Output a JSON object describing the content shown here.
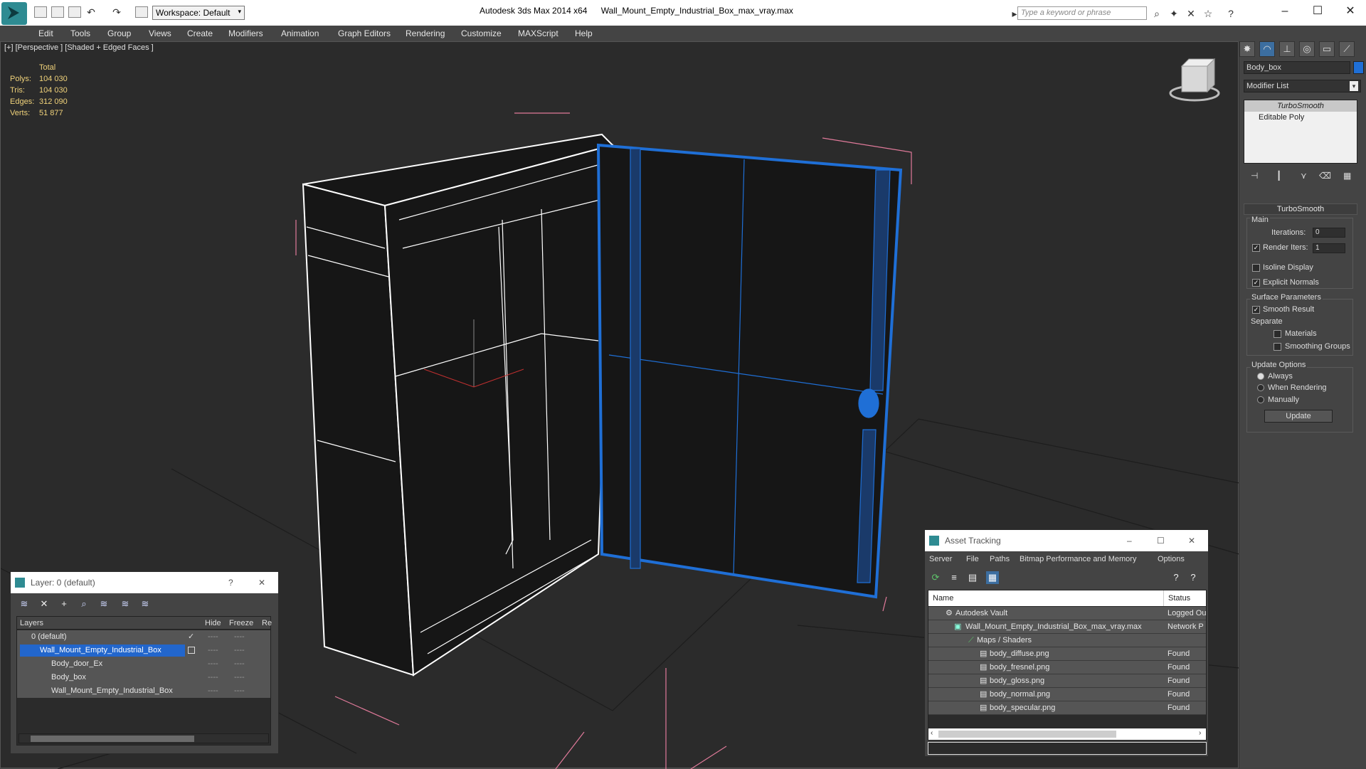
{
  "titlebar": {
    "workspace": "Workspace: Default",
    "app_title": "Autodesk 3ds Max  2014 x64",
    "file_name": "Wall_Mount_Empty_Industrial_Box_max_vray.max",
    "search_placeholder": "Type a keyword or phrase"
  },
  "menu": [
    "Edit",
    "Tools",
    "Group",
    "Views",
    "Create",
    "Modifiers",
    "Animation",
    "Graph Editors",
    "Rendering",
    "Customize",
    "MAXScript",
    "Help"
  ],
  "viewport": {
    "label": "[+] [Perspective ] [Shaded + Edged Faces ]",
    "stats": {
      "header": "Total",
      "rows": [
        {
          "label": "Polys:",
          "value": "104 030"
        },
        {
          "label": "Tris:",
          "value": "104 030"
        },
        {
          "label": "Edges:",
          "value": "312 090"
        },
        {
          "label": "Verts:",
          "value": "51 877"
        }
      ]
    }
  },
  "command_panel": {
    "object_name": "Body_box",
    "modifier_list": "Modifier List",
    "stack": [
      "TurboSmooth",
      "Editable Poly"
    ],
    "rollout_title": "TurboSmooth",
    "main_label": "Main",
    "iterations_label": "Iterations:",
    "iterations_value": "0",
    "render_iters_label": "Render Iters:",
    "render_iters_value": "1",
    "isoline_label": "Isoline Display",
    "explicit_normals_label": "Explicit Normals",
    "surface_params_label": "Surface Parameters",
    "smooth_result_label": "Smooth Result",
    "separate_label": "Separate",
    "materials_label": "Materials",
    "smoothing_groups_label": "Smoothing Groups",
    "update_options_label": "Update Options",
    "always_label": "Always",
    "when_rendering_label": "When Rendering",
    "manually_label": "Manually",
    "update_button": "Update"
  },
  "layer_window": {
    "title": "Layer: 0 (default)",
    "help": "?",
    "columns": [
      "Layers",
      "Hide",
      "Freeze",
      "Re"
    ],
    "rows": [
      {
        "name": "0 (default)",
        "hide": "----",
        "freeze": "----"
      },
      {
        "name": "Wall_Mount_Empty_Industrial_Box",
        "hide": "----",
        "freeze": "----"
      },
      {
        "name": "Body_door_Ex",
        "hide": "----",
        "freeze": "----"
      },
      {
        "name": "Body_box",
        "hide": "----",
        "freeze": "----"
      },
      {
        "name": "Wall_Mount_Empty_Industrial_Box",
        "hide": "----",
        "freeze": "----"
      }
    ]
  },
  "asset_window": {
    "title": "Asset Tracking",
    "menu": [
      "Server",
      "File",
      "Paths",
      "Bitmap Performance and Memory",
      "Options"
    ],
    "col_name": "Name",
    "col_status": "Status",
    "rows": [
      {
        "name": "Autodesk Vault",
        "status": "Logged Ou"
      },
      {
        "name": "Wall_Mount_Empty_Industrial_Box_max_vray.max",
        "status": "Network P"
      },
      {
        "name": "Maps / Shaders",
        "status": ""
      },
      {
        "name": "body_diffuse.png",
        "status": "Found"
      },
      {
        "name": "body_fresnel.png",
        "status": "Found"
      },
      {
        "name": "body_gloss.png",
        "status": "Found"
      },
      {
        "name": "body_normal.png",
        "status": "Found"
      },
      {
        "name": "body_specular.png",
        "status": "Found"
      }
    ]
  },
  "colors": {
    "accent_blue": "#1f6fd6",
    "selection": "#2266cc",
    "stat_yellow": "#f0d27a",
    "wire": "#ffffff",
    "bbox_pink": "#e07a9a"
  }
}
